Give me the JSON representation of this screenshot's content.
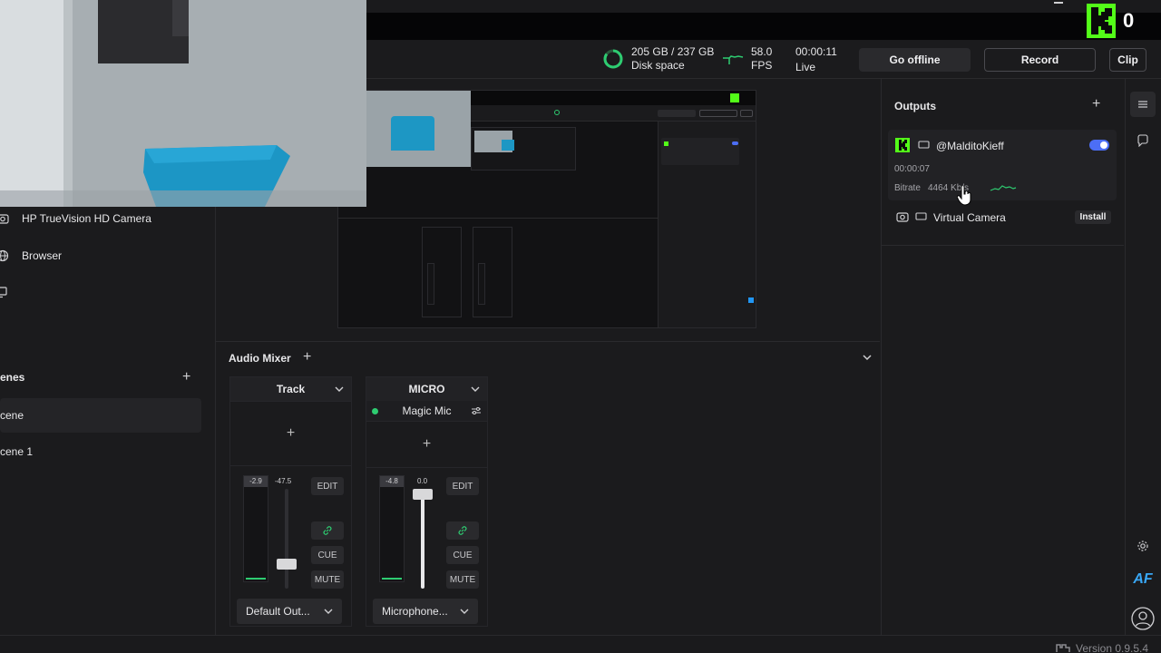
{
  "badge": {
    "count": "0"
  },
  "stats": {
    "disk_value": "205 GB / 237 GB",
    "disk_label": "Disk space",
    "fps_value": "58.0",
    "fps_label": "FPS",
    "time_value": "00:00:11",
    "time_label": "Live"
  },
  "actions": {
    "go_offline": "Go offline",
    "record": "Record",
    "clip": "Clip"
  },
  "sources": {
    "items": [
      {
        "label": "HP TrueVision HD Camera",
        "icon": "camera-icon"
      },
      {
        "label": "Browser",
        "icon": "globe-icon"
      },
      {
        "label": "",
        "icon": "monitor-icon"
      }
    ]
  },
  "scenes": {
    "title": "enes",
    "items": [
      {
        "label": "cene",
        "active": true
      },
      {
        "label": "cene 1",
        "active": false
      }
    ]
  },
  "mixer": {
    "title": "Audio Mixer",
    "strips": [
      {
        "name": "Track",
        "device": "",
        "meter_db": "-2.9",
        "fader_db": "-47.5",
        "edit": "EDIT",
        "cue": "CUE",
        "mute": "MUTE",
        "output": "Default Out..."
      },
      {
        "name": "MICRO",
        "device": "Magic Mic",
        "meter_db": "-4.8",
        "fader_db": "0.0",
        "edit": "EDIT",
        "cue": "CUE",
        "mute": "MUTE",
        "output": "Microphone..."
      }
    ]
  },
  "outputs": {
    "title": "Outputs",
    "items": [
      {
        "name": "@MalditoKieff",
        "elapsed": "00:00:07",
        "bitrate_label": "Bitrate",
        "bitrate_value": "4464 Kb/s",
        "enabled": true
      },
      {
        "name": "Virtual Camera",
        "action": "Install"
      }
    ]
  },
  "rightbar": {
    "avatar_initials": "AF"
  },
  "status": {
    "version": "Version 0.9.5.4"
  },
  "colors": {
    "kick_green": "#53fc18",
    "accent": "#4c6ef5",
    "live_green": "#2ecc71"
  }
}
